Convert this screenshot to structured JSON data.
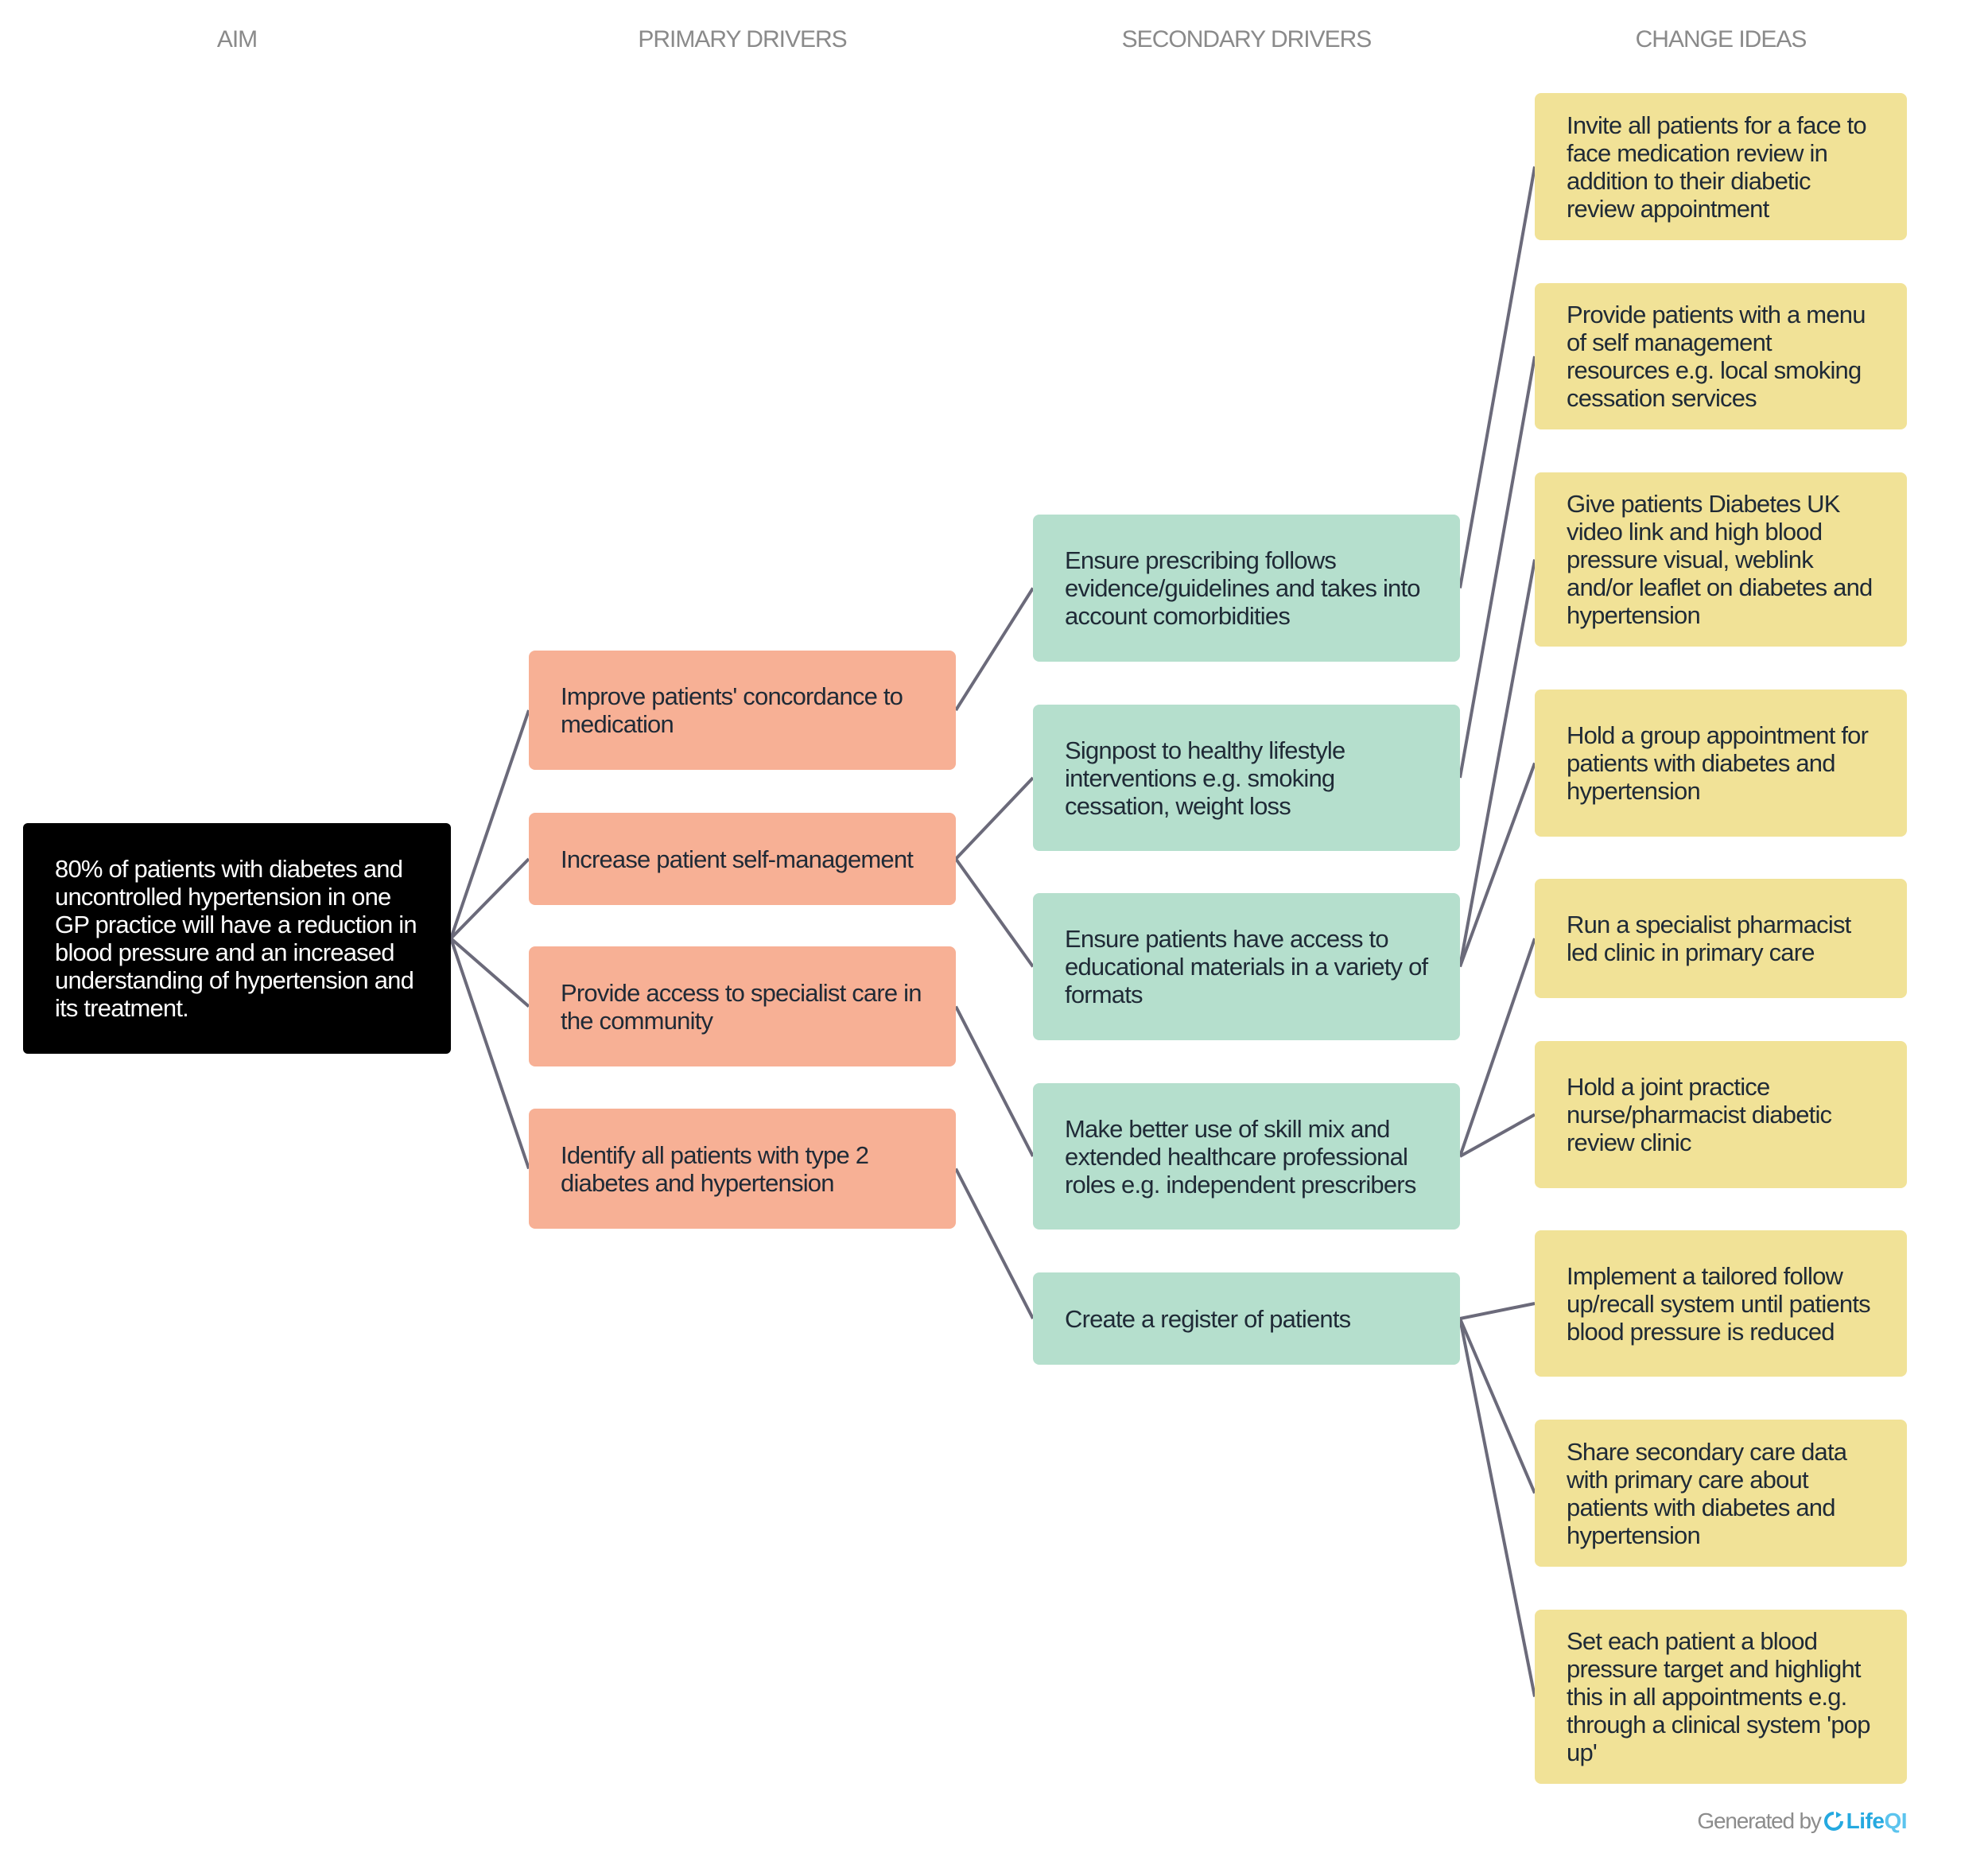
{
  "headers": {
    "aim": "AIM",
    "primary": "PRIMARY DRIVERS",
    "secondary": "SECONDARY DRIVERS",
    "change": "CHANGE IDEAS"
  },
  "aim": {
    "text": "80% of patients with diabetes and uncontrolled hypertension in one GP practice will have a reduction in blood pressure and an increased understanding of hypertension and its treatment."
  },
  "primary_drivers": [
    {
      "text": "Improve patients' concordance to medication",
      "links_to_secondary": [
        0
      ]
    },
    {
      "text": "Increase patient self-management",
      "links_to_secondary": [
        1,
        2
      ]
    },
    {
      "text": "Provide access to specialist care in the community",
      "links_to_secondary": [
        3
      ]
    },
    {
      "text": "Identify all patients with type 2 diabetes and hypertension",
      "links_to_secondary": [
        4
      ]
    }
  ],
  "secondary_drivers": [
    {
      "text": "Ensure prescribing follows evidence/guidelines and takes into account comorbidities",
      "links_to_change": [
        0
      ]
    },
    {
      "text": "Signpost to healthy lifestyle interventions e.g. smoking cessation, weight loss",
      "links_to_change": [
        1
      ]
    },
    {
      "text": "Ensure patients have access to educational materials in a variety of formats",
      "links_to_change": [
        2,
        3
      ]
    },
    {
      "text": "Make better use of skill mix and extended healthcare professional roles e.g. independent prescribers",
      "links_to_change": [
        4,
        5
      ]
    },
    {
      "text": "Create a register of patients",
      "links_to_change": [
        6,
        7,
        8
      ]
    }
  ],
  "change_ideas": [
    {
      "text": "Invite all patients for a face to face medication review in addition to their diabetic review appointment"
    },
    {
      "text": "Provide patients with a menu of self management resources e.g. local smoking cessation services"
    },
    {
      "text": "Give patients Diabetes UK video link and high blood pressure visual, weblink and/or leaflet on diabetes and hypertension"
    },
    {
      "text": "Hold a group appointment for patients with diabetes and hypertension"
    },
    {
      "text": "Run a specialist pharmacist led clinic in primary care"
    },
    {
      "text": "Hold a joint practice nurse/pharmacist diabetic review clinic"
    },
    {
      "text": "Implement a tailored follow up/recall system until patients blood pressure is reduced"
    },
    {
      "text": "Share secondary care data with primary care about patients with diabetes and hypertension"
    },
    {
      "text": "Set each patient a blood pressure target and highlight this in all appointments e.g. through a clinical system 'pop up'"
    }
  ],
  "colors": {
    "aim": "#000000",
    "primary": "#f7b095",
    "secondary": "#b5dfcd",
    "change": "#f1e297",
    "connector": "#6b6a7a",
    "header_text": "#8a8a8a",
    "brand": "#25a9e0"
  },
  "footer": {
    "prefix": "Generated by",
    "brand_life": "Life",
    "brand_qi": "QI",
    "logo_icon": "refresh-circle-icon"
  }
}
